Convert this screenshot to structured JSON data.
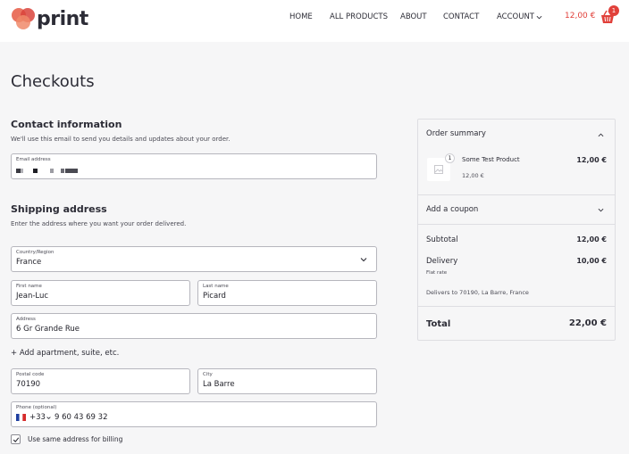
{
  "header": {
    "logo_text": "print",
    "nav": [
      "HOME",
      "ALL PRODUCTS",
      "ABOUT",
      "CONTACT",
      "ACCOUNT"
    ],
    "cart_total": "12,00 €",
    "cart_count": "1"
  },
  "page": {
    "title": "Checkouts"
  },
  "contact": {
    "title": "Contact information",
    "subtitle": "We'll use this email to send you details and updates about your order.",
    "email_label": "Email address"
  },
  "shipping": {
    "title": "Shipping address",
    "subtitle": "Enter the address where you want your order delivered.",
    "country_label": "Country/Region",
    "country_value": "France",
    "first_name_label": "First name",
    "first_name_value": "Jean-Luc",
    "last_name_label": "Last name",
    "last_name_value": "Picard",
    "address_label": "Address",
    "address_value": "6 Gr Grande Rue",
    "add_apartment": "+ Add apartment, suite, etc.",
    "postal_label": "Postal code",
    "postal_value": "70190",
    "city_label": "City",
    "city_value": "La Barre",
    "phone_label": "Phone (optional)",
    "phone_code": "+33",
    "phone_value": "9 60 43 69 32",
    "billing_checkbox": "Use same address for billing",
    "billing_checked": true
  },
  "summary": {
    "title": "Order summary",
    "item_qty": "1",
    "item_name": "Some Test Product",
    "item_total": "12,00 €",
    "item_unit_price": "12,00 €",
    "coupon_label": "Add a coupon",
    "subtotal_label": "Subtotal",
    "subtotal_value": "12,00 €",
    "delivery_label": "Delivery",
    "delivery_value": "10,00 €",
    "delivery_method": "Flat rate",
    "delivers_to": "Delivers to 70190, La Barre, France",
    "total_label": "Total",
    "total_value": "22,00 €"
  },
  "colors": {
    "accent": "#e1403a",
    "text": "#2c2c36",
    "background": "#f6f6f7"
  }
}
